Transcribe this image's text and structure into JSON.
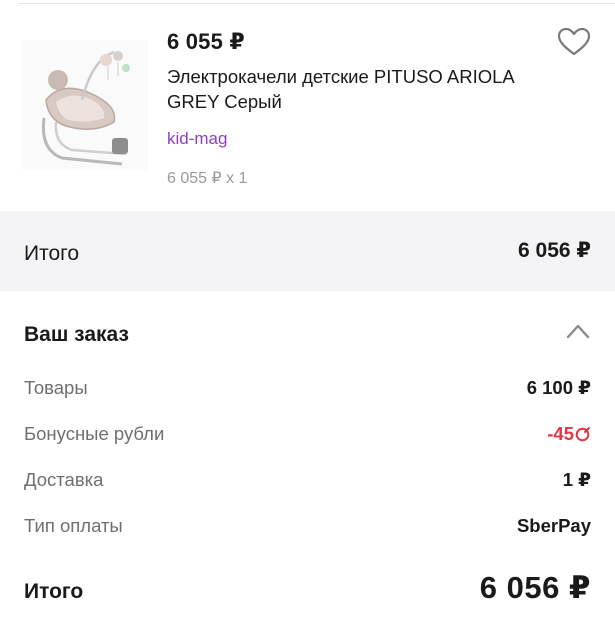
{
  "product": {
    "price": "6 055 ₽",
    "title": "Электрокачели детские PITUSO ARIOLA GREY Серый",
    "seller": "kid-mag",
    "quantity_line": "6 055 ₽ x 1",
    "image_icon": "baby-swing-image",
    "favorite_icon": "heart-outline-icon"
  },
  "total_bar": {
    "label": "Итого",
    "value": "6 056 ₽"
  },
  "order": {
    "heading": "Ваш заказ",
    "collapse_icon": "chevron-up-icon",
    "rows": [
      {
        "label": "Товары",
        "value": "6 100 ₽"
      },
      {
        "label": "Бонусные рубли",
        "value": "-45"
      },
      {
        "label": "Доставка",
        "value": "1 ₽"
      },
      {
        "label": "Тип оплаты",
        "value": "SberPay"
      }
    ],
    "final_label": "Итого",
    "final_value": "6 056 ₽"
  },
  "colors": {
    "seller_link": "#8e3fc2",
    "bonus_negative": "#e33545",
    "section_gap": "#f4f4f6"
  }
}
